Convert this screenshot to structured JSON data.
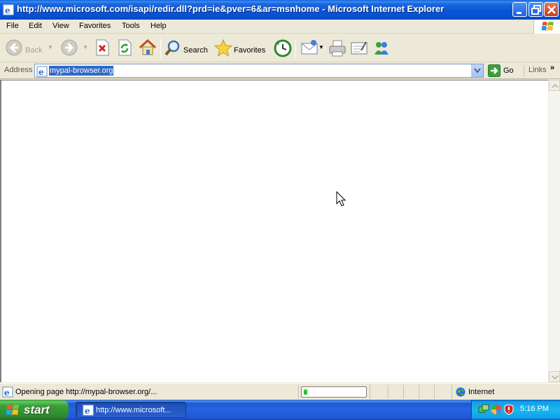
{
  "window": {
    "title": "http://www.microsoft.com/isapi/redir.dll?prd=ie&pver=6&ar=msnhome - Microsoft Internet Explorer"
  },
  "menu": {
    "items": [
      "File",
      "Edit",
      "View",
      "Favorites",
      "Tools",
      "Help"
    ]
  },
  "toolbar": {
    "back_label": "Back",
    "search_label": "Search",
    "favorites_label": "Favorites"
  },
  "address_bar": {
    "label": "Address",
    "value": "mypal-browser.org",
    "go_label": "Go",
    "links_label": "Links",
    "links_chevron": "»"
  },
  "status_bar": {
    "text": "Opening page http://mypal-browser.org/...",
    "progress": 0.06,
    "zone": "Internet"
  },
  "taskbar": {
    "start_label": "start",
    "task_label": "http://www.microsoft...",
    "clock": "5:16 PM"
  },
  "colors": {
    "title_bar": "#0855d6",
    "selection": "#316ac5",
    "taskbar": "#2663e0",
    "start_button": "#3a9e3a",
    "progress": "#1eb51e"
  },
  "icons": [
    "ie-icon",
    "minimize-icon",
    "maximize-icon",
    "close-icon",
    "windows-logo-icon",
    "back-arrow-icon",
    "forward-arrow-icon",
    "stop-icon",
    "refresh-icon",
    "home-icon",
    "search-icon",
    "favorites-star-icon",
    "history-icon",
    "mail-icon",
    "print-icon",
    "edit-icon",
    "messenger-icon",
    "go-arrow-icon",
    "globe-icon",
    "mouse-cursor-icon"
  ]
}
